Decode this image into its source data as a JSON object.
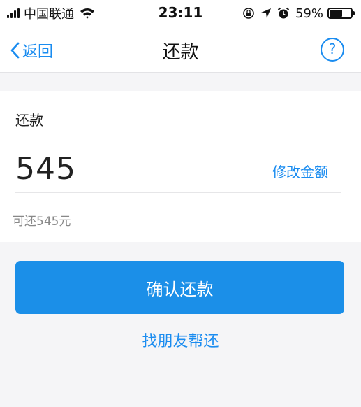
{
  "status_bar": {
    "carrier": "中国联通",
    "time": "23:11",
    "battery": "59%",
    "battery_level": 0.59,
    "icons": [
      "signal-icon",
      "wifi-icon",
      "orientation-lock-icon",
      "location-icon",
      "alarm-icon",
      "battery-icon"
    ]
  },
  "nav": {
    "back_label": "返回",
    "title": "还款",
    "help_label": "?"
  },
  "repayment": {
    "label": "还款",
    "amount": "545",
    "modify_label": "修改金额",
    "available_text": "可还545元"
  },
  "actions": {
    "confirm_label": "确认还款",
    "friend_label": "找朋友帮还"
  },
  "colors": {
    "accent": "#1a8cf0",
    "button": "#1b8fe8",
    "background": "#f5f5f7"
  }
}
